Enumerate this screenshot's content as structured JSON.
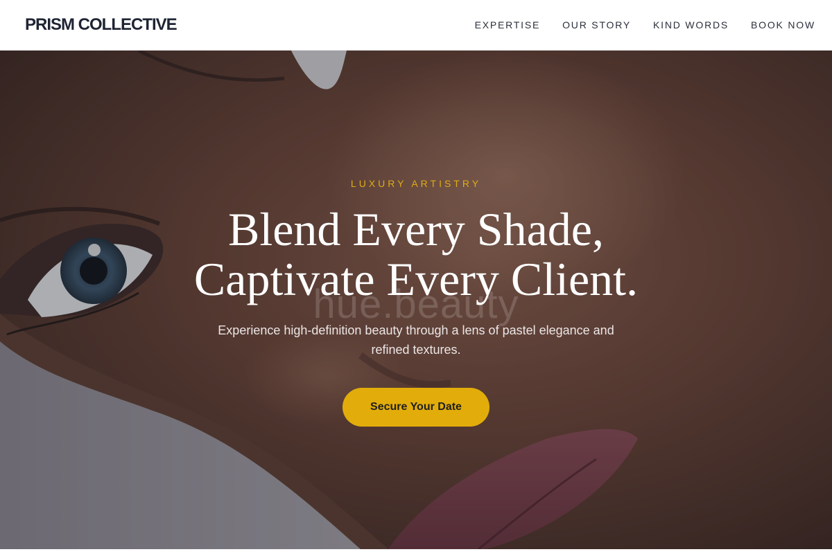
{
  "brand": {
    "name": "PRISM COLLECTIVE"
  },
  "nav": {
    "items": [
      {
        "label": "EXPERTISE"
      },
      {
        "label": "OUR STORY"
      },
      {
        "label": "KIND WORDS"
      },
      {
        "label": "BOOK NOW"
      }
    ]
  },
  "hero": {
    "eyebrow": "LUXURY ARTISTRY",
    "headline_line1": "Blend Every Shade,",
    "headline_line2": "Captivate Every Client.",
    "subtext": "Experience high-definition beauty through a lens of pastel elegance and refined textures.",
    "cta_label": "Secure Your Date",
    "watermark": "hue.beauty"
  },
  "colors": {
    "accent": "#e2ad0a",
    "eyebrow": "#e0ac16",
    "brand_text": "#1e2433",
    "nav_text": "#2a2f3a"
  }
}
